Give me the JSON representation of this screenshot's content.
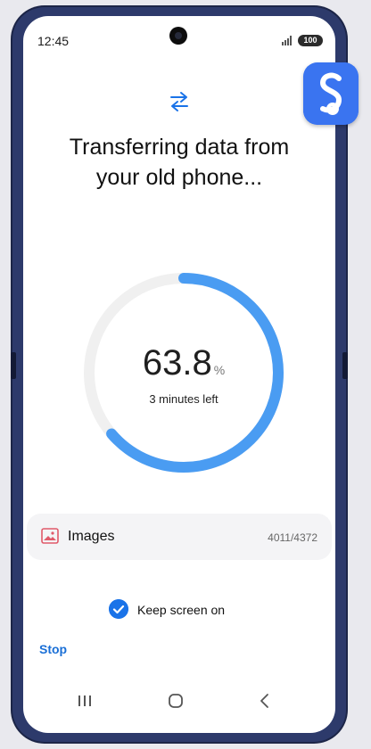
{
  "status_bar": {
    "time": "12:45",
    "battery": "100"
  },
  "icons": {
    "transfer": "transfer-arrows-icon",
    "category": "image-icon",
    "check": "check-circle-icon",
    "logo": "smart-switch-logo"
  },
  "main": {
    "title_line1": "Transferring data from",
    "title_line2": "your old phone...",
    "progress": {
      "value": "63.8",
      "unit": "%",
      "fraction": 0.638,
      "time_left": "3 minutes left"
    },
    "category": {
      "label": "Images",
      "count": "4011/4372"
    },
    "keep_screen_on": {
      "label": "Keep screen on",
      "checked": true
    },
    "stop_label": "Stop"
  },
  "colors": {
    "accent": "#1a73e8",
    "progress_ring": "#4a9cf2",
    "progress_track": "#f0f0f0",
    "image_icon": "#e05a6a"
  }
}
